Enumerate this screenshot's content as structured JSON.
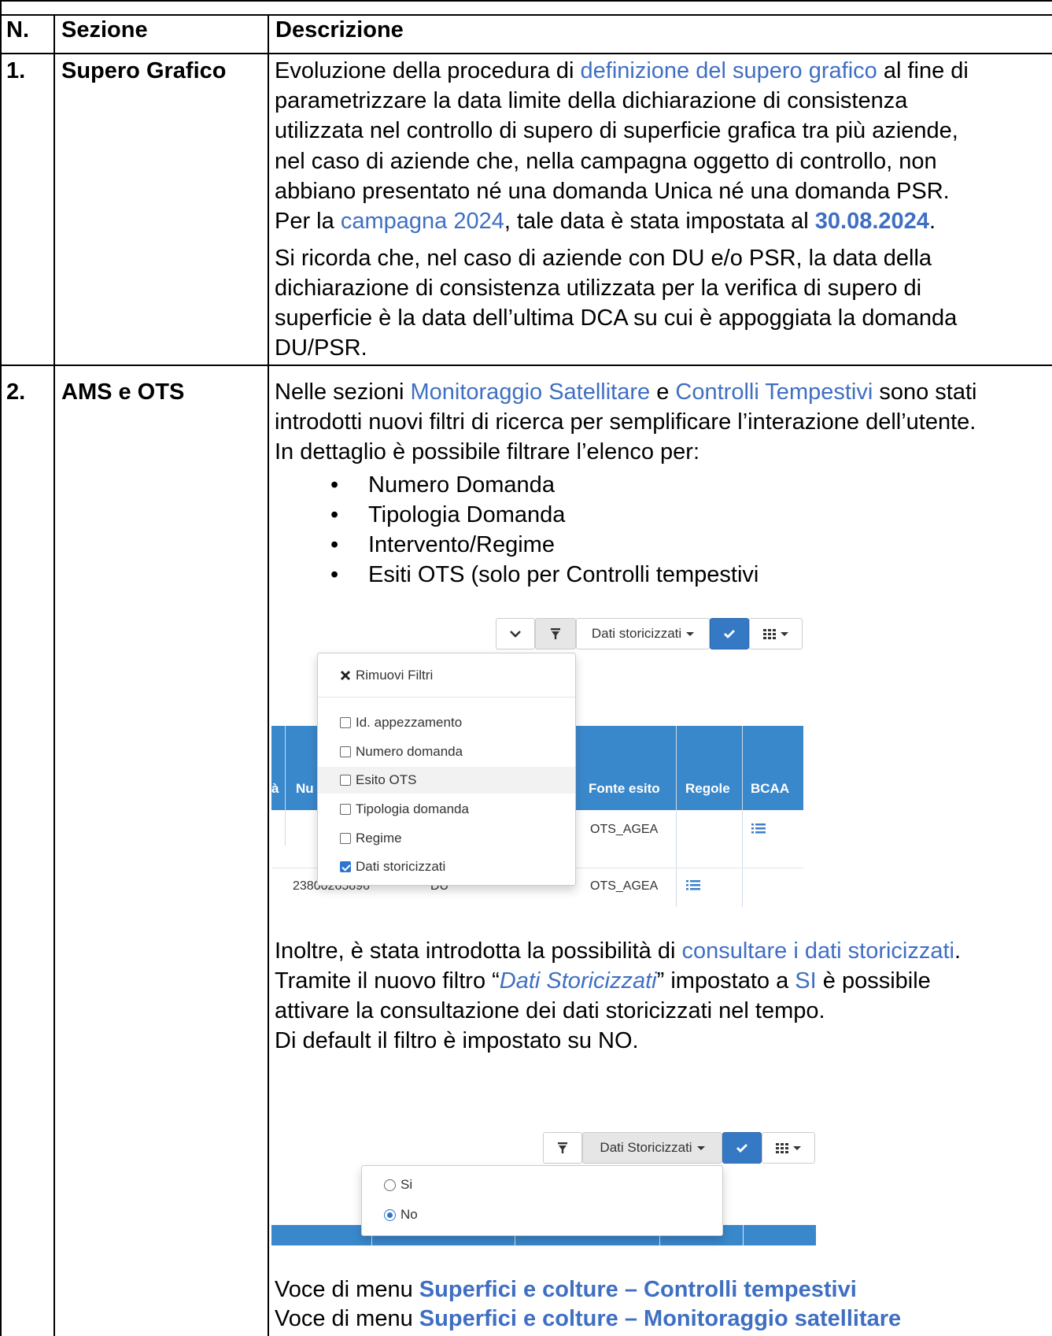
{
  "table": {
    "headers": {
      "n": "N.",
      "section": "Sezione",
      "description": "Descrizione"
    },
    "rows": [
      {
        "n": "1.",
        "section": "Supero Grafico",
        "p1_line1_pre": "Evoluzione della procedura di ",
        "p1_line1_link": "definizione del supero grafico",
        "p1_line1_post": " al fine di",
        "p1_line2": "parametrizzare la data limite della dichiarazione di consistenza",
        "p1_line3": "utilizzata nel controllo di supero di superficie grafica tra più aziende,",
        "p1_line4": "nel caso di aziende che, nella campagna oggetto di controllo, non",
        "p1_line5": "abbiano presentato né una domanda Unica né una domanda PSR.",
        "p1_line6_pre": "Per la ",
        "p1_line6_link": "campagna 2024",
        "p1_line6_mid": ", tale data è stata impostata al ",
        "p1_line6_date": "30.08.2024",
        "p1_line6_end": ".",
        "p2_line1": "Si ricorda che, nel caso di aziende con DU e/o PSR, la data della",
        "p2_line2": "dichiarazione di consistenza utilizzata per la verifica di supero di",
        "p2_line3": "superficie è la data dell’ultima DCA su cui è appoggiata la domanda",
        "p2_line4": "DU/PSR."
      },
      {
        "n": "2.",
        "section": "AMS e OTS",
        "intro_line1_pre": "Nelle sezioni ",
        "intro_line1_link1": "Monitoraggio Satellitare",
        "intro_line1_mid": " e ",
        "intro_line1_link2": "Controlli Tempestivi",
        "intro_line1_post": " sono stati",
        "intro_line2": "introdotti nuovi filtri di ricerca per semplificare l’interazione dell’utente.",
        "intro_line3": "In dettaglio è possibile filtrare l’elenco per:",
        "bullets": [
          "Numero Domanda",
          "Tipologia Domanda",
          "Intervento/Regime",
          "Esiti OTS (solo per Controlli tempestivi"
        ],
        "more_line1_pre": "Inoltre, è stata introdotta la possibilità di ",
        "more_line1_link": "consultare i dati storicizzati",
        "more_line1_end": ".",
        "more_line2_pre": "Tramite il nuovo filtro “",
        "more_line2_italic": "Dati Storicizzati",
        "more_line2_mid": "” impostato a ",
        "more_line2_si": "SI",
        "more_line2_end": " è possibile",
        "more_line3": "attivare la consultazione dei dati storicizzati nel tempo.",
        "more_line4": "Di default il filtro è impostato su NO.",
        "menu1_pre": "Voce di menu ",
        "menu1_bold": "Superfici e colture – Controlli tempestivi",
        "menu2_pre": "Voce di menu ",
        "menu2_bold": "Superfici e colture – Monitoraggio satellitare"
      }
    ]
  },
  "screenshot1": {
    "toolbar": {
      "dropdown_label": "Dati storicizzati"
    },
    "filter_menu": {
      "remove_label": "Rimuovi Filtri",
      "items": [
        {
          "label": "Id. appezzamento",
          "checked": false
        },
        {
          "label": "Numero domanda",
          "checked": false
        },
        {
          "label": "Esito OTS",
          "checked": false
        },
        {
          "label": "Tipologia domanda",
          "checked": false
        },
        {
          "label": "Regime",
          "checked": false
        },
        {
          "label": "Dati storicizzati",
          "checked": true
        }
      ]
    },
    "table_headers": {
      "partial_a": "à",
      "partial_nu": "Nu",
      "fonte": "Fonte esito",
      "regole": "Regole",
      "bcaa": "BCAA"
    },
    "rows": [
      {
        "fonte": "OTS_AGEA"
      },
      {
        "numero": "23800265896",
        "tipo": "DU",
        "fonte": "OTS_AGEA"
      }
    ]
  },
  "screenshot2": {
    "toolbar": {
      "dropdown_label": "Dati Storicizzati"
    },
    "options": [
      {
        "label": "Si",
        "selected": false
      },
      {
        "label": "No",
        "selected": true
      }
    ]
  },
  "colors": {
    "link_blue": "#3f6fc2",
    "header_blue": "#3a88cc",
    "primary_button": "#3579c4"
  }
}
